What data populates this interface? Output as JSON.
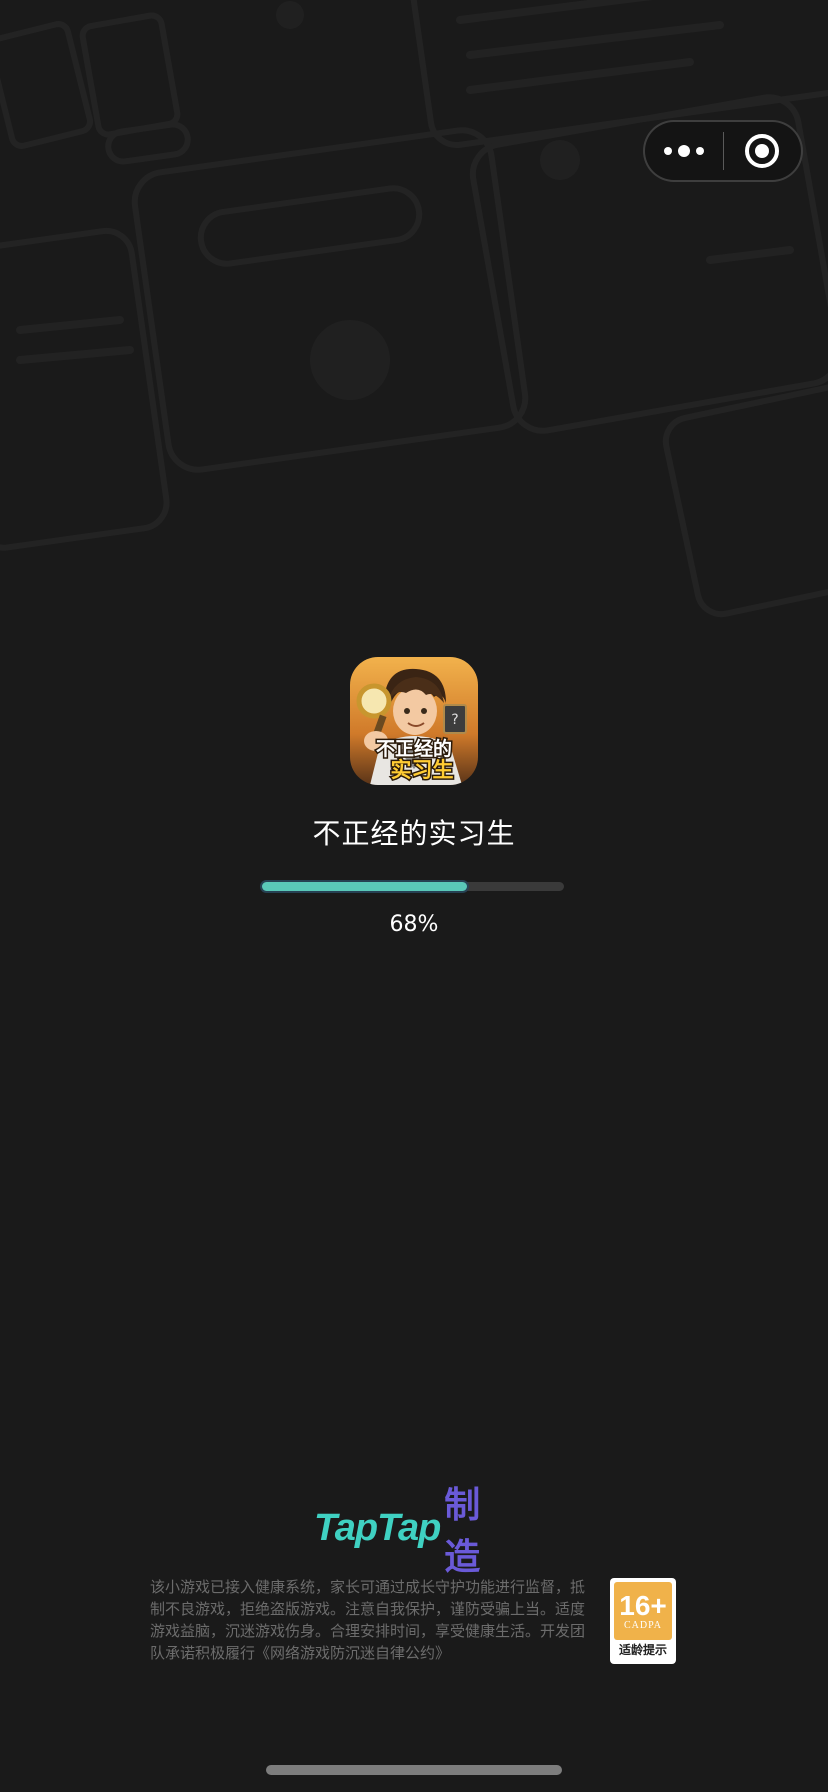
{
  "capsule": {
    "more_icon": "more-dots-icon",
    "close_icon": "exit-target-icon"
  },
  "game": {
    "icon_text": "不正经的实习生",
    "title": "不正经的实习生",
    "progress_percent": 68,
    "progress_label": "68%"
  },
  "footer": {
    "brand_latin": "TapTap",
    "brand_cjk": "制造",
    "notice": "该小游戏已接入健康系统，家长可通过成长守护功能进行监督，抵制不良游戏，拒绝盗版游戏。注意自我保护，谨防受骗上当。适度游戏益脑，沉迷游戏伤身。合理安排时间，享受健康生活。开发团队承诺积极履行《网络游戏防沉迷自律公约》",
    "age_rating": {
      "number": "16+",
      "org": "CADPA",
      "caption": "适龄提示"
    }
  },
  "colors": {
    "background": "#1a1a1a",
    "progress_fill": "#5ac8b8",
    "progress_track": "#3a3a3a",
    "brand_teal": "#3fd1c2",
    "brand_purple": "#6a5ad8",
    "age_orange": "#f0b24a"
  }
}
